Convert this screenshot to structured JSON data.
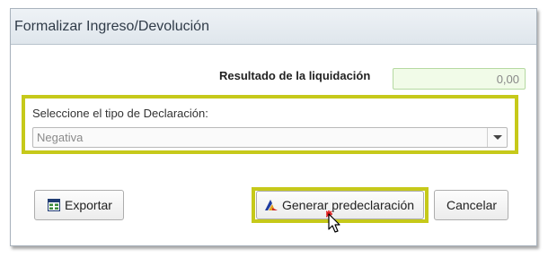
{
  "dialog": {
    "title": "Formalizar Ingreso/Devolución"
  },
  "result": {
    "label": "Resultado de la liquidación",
    "value": "0,00"
  },
  "declaration": {
    "label": "Seleccione el tipo de Declaración:",
    "selected": "Negativa"
  },
  "buttons": {
    "export": "Exportar",
    "generate": "Generar predeclaración",
    "cancel": "Cancelar"
  },
  "icons": {
    "export": "export-table-icon",
    "generate": "generate-declaration-icon",
    "dropdown": "chevron-down-icon",
    "cursor": "mouse-pointer-icon"
  },
  "colors": {
    "highlight": "#c6c91a",
    "result_field_bg": "#f1fbe8",
    "titlebar": "#dfe6ec"
  }
}
